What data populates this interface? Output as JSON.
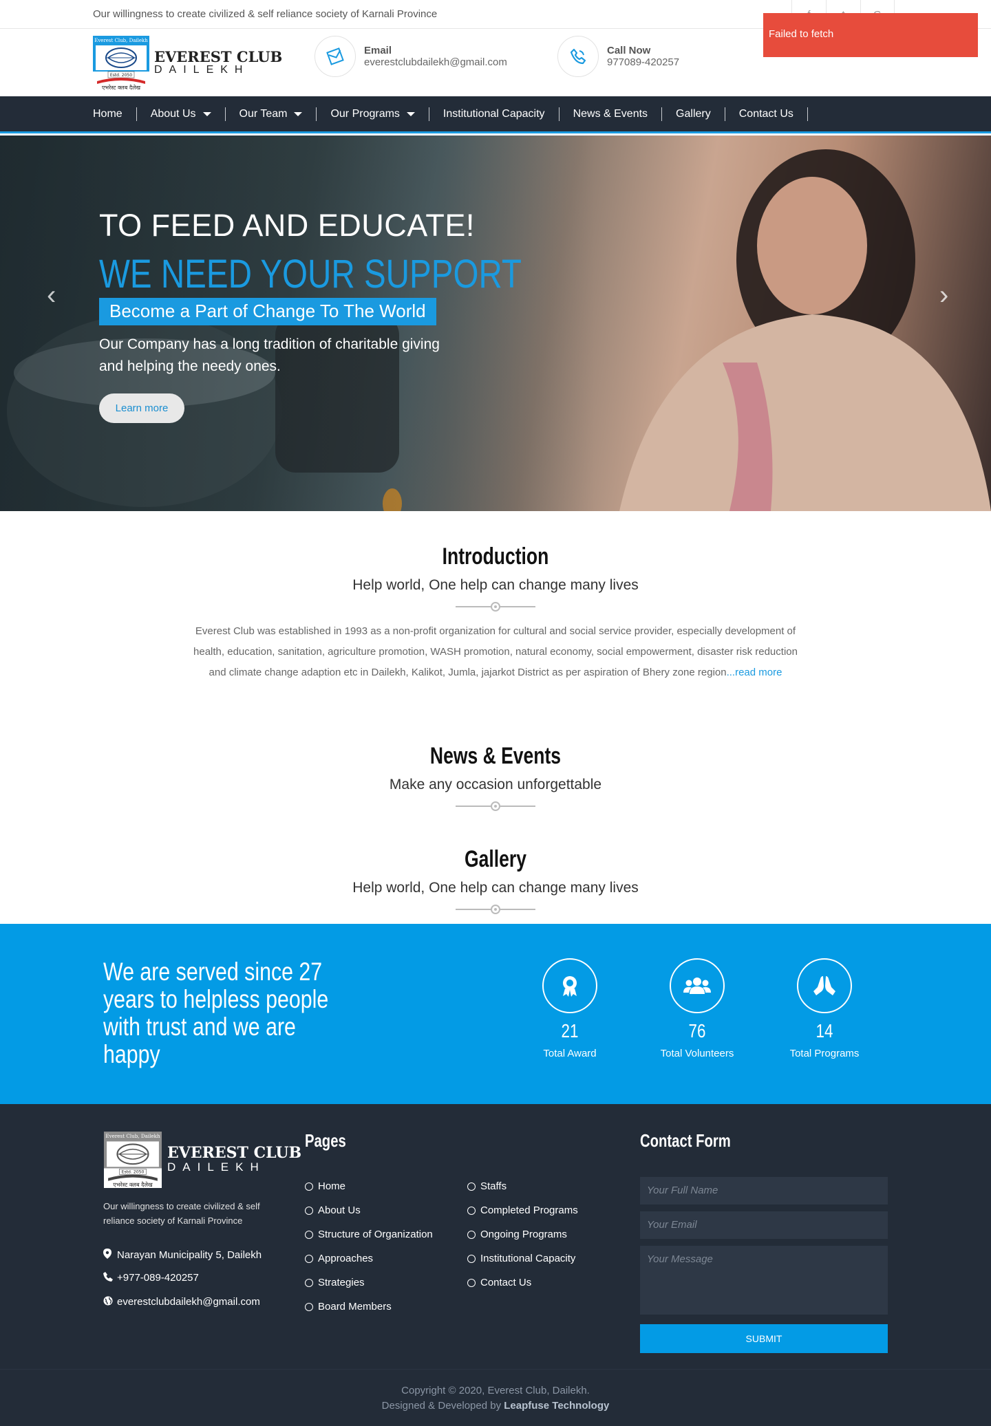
{
  "topbar": {
    "tagline": "Our willingness to create civilized & self reliance society of Karnali Province",
    "social": [
      "f",
      "t",
      "G"
    ],
    "toast": "Failed to fetch"
  },
  "header": {
    "logo_line1": "EVEREST CLUB",
    "logo_line2": "DAILEKH",
    "logo_small_top": "Everest Club, Dailekh",
    "logo_small_estd": "Estd. 2050",
    "logo_small_nepali": "एभरेस्ट क्लब दैलेख",
    "email_label": "Email",
    "email_value": "everestclubdailekh@gmail.com",
    "call_label": "Call Now",
    "call_value": "977089-420257"
  },
  "nav": {
    "items": [
      {
        "label": "Home",
        "dropdown": false
      },
      {
        "label": "About Us",
        "dropdown": true
      },
      {
        "label": "Our Team",
        "dropdown": true
      },
      {
        "label": "Our Programs",
        "dropdown": true
      },
      {
        "label": "Institutional Capacity",
        "dropdown": false
      },
      {
        "label": "News & Events",
        "dropdown": false
      },
      {
        "label": "Gallery",
        "dropdown": false
      },
      {
        "label": "Contact Us",
        "dropdown": false
      }
    ]
  },
  "hero": {
    "line1": "TO FEED AND EDUCATE!",
    "line2": "WE NEED YOUR SUPPORT",
    "pill": "Become a Part of Change To The World",
    "text": "Our Company has a long tradition of charitable giving and helping the needy ones.",
    "button": "Learn more",
    "prev": "‹",
    "next": "›"
  },
  "intro": {
    "title": "Introduction",
    "subtitle": "Help world, One help can change many lives",
    "text": "Everest Club was established in 1993 as a non-profit organization for cultural and social service provider, especially development of health, education, sanitation, agriculture promotion, WASH promotion, natural economy, social empowerment, disaster risk reduction and climate change adaption etc in Dailekh, Kalikot, Jumla, jajarkot District as per aspiration of Bhery zone region",
    "read_more": "...read more"
  },
  "news": {
    "title": "News & Events",
    "subtitle": "Make any occasion unforgettable"
  },
  "gallery": {
    "title": "Gallery",
    "subtitle": "Help world, One help can change many lives"
  },
  "stats": {
    "lead": "We are served since 27 years to helpless people with trust and we are happy",
    "items": [
      {
        "value": "21",
        "label": "Total Award",
        "icon": "award-icon"
      },
      {
        "value": "76",
        "label": "Total Volunteers",
        "icon": "users-icon"
      },
      {
        "value": "14",
        "label": "Total Programs",
        "icon": "praying-hands-icon"
      }
    ]
  },
  "footer": {
    "tagline": "Our willingness to create civilized & self reliance society of Karnali Province",
    "address": "Narayan Municipality 5, Dailekh",
    "phone": "+977-089-420257",
    "email": "everestclubdailekh@gmail.com",
    "pages_title": "Pages",
    "pages_col1": [
      "Home",
      "About Us",
      "Structure of Organization",
      "Approaches",
      "Strategies",
      "Board Members"
    ],
    "pages_col2": [
      "Staffs",
      "Completed Programs",
      "Ongoing Programs",
      "Institutional Capacity",
      "Contact Us"
    ],
    "contact_title": "Contact Form",
    "name_placeholder": "Your Full Name",
    "email_placeholder": "Your Email",
    "message_placeholder": "Your Message",
    "submit": "SUBMIT",
    "copyright": "Copyright © 2020, Everest Club, Dailekh.",
    "designed_by": "Designed & Developed by",
    "developer": "Leapfuse Technology"
  },
  "colors": {
    "accent": "#039be5",
    "nav_bg": "#232c38",
    "toast": "#e74c3c"
  }
}
